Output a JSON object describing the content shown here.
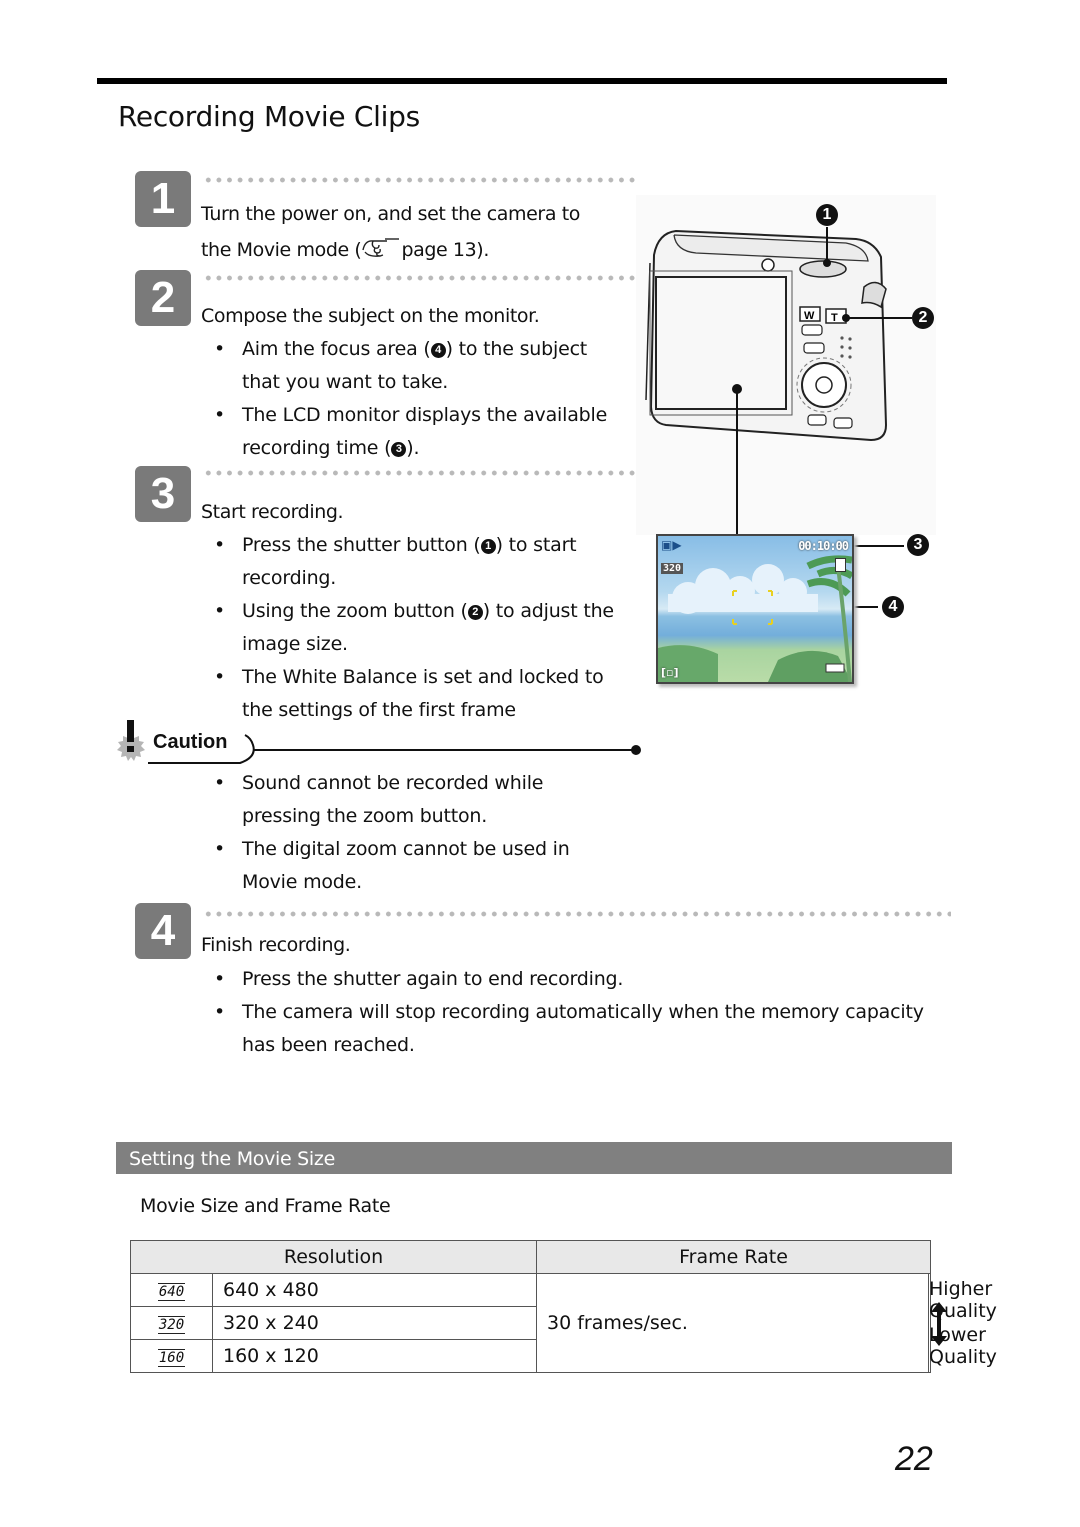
{
  "page": {
    "title": "Recording Movie Clips",
    "page_number": "22"
  },
  "steps": [
    {
      "number": "1",
      "heading_line1": "Turn the power on, and set the camera to",
      "heading_line2_prefix": "the Movie mode (",
      "heading_line2_suffix": "page 13).",
      "reference_icon": "pointing-hand-icon",
      "bullets": []
    },
    {
      "number": "2",
      "heading": "Compose the subject on the monitor.",
      "bullets": [
        {
          "pre": "Aim the focus area (",
          "callout": "4",
          "post": ") to the subject",
          "line2": "that you want to take."
        },
        {
          "pre": "The LCD monitor displays the available",
          "callout": "",
          "post": "",
          "line2_pre": "recording time (",
          "line2_callout": "3",
          "line2_post": ")."
        }
      ]
    },
    {
      "number": "3",
      "heading": "Start recording.",
      "bullets": [
        {
          "pre": "Press the shutter button (",
          "callout": "1",
          "post": ") to start",
          "line2": "recording."
        },
        {
          "pre": "Using the zoom button (",
          "callout": "2",
          "post": ") to adjust the",
          "line2": "image size."
        },
        {
          "pre": "The White Balance is set and locked to",
          "callout": "",
          "post": "",
          "line2": "the settings of the first frame"
        }
      ]
    },
    {
      "number": "4",
      "heading": "Finish recording.",
      "bullets": [
        {
          "line1": "Press the shutter again to end recording."
        },
        {
          "line1": "The camera will stop recording automatically when the memory capacity",
          "line2": "has been reached."
        }
      ]
    }
  ],
  "caution": {
    "label": "Caution",
    "icon": "caution-exclamation-icon",
    "bullets": [
      {
        "line1": "Sound cannot be recorded while",
        "line2": "pressing the zoom button."
      },
      {
        "line1": "The digital zoom cannot be used in",
        "line2": "Movie mode."
      }
    ]
  },
  "illustration": {
    "callouts": [
      "1",
      "2",
      "3",
      "4"
    ],
    "lcd": {
      "timer": "00:10:00",
      "size_icon": "320",
      "mode_icon": "movie-camera-icon",
      "focus_icon": "focus-frame-icon",
      "battery_icon": "battery-icon",
      "memory_icon": "memory-card-icon"
    },
    "zoom_buttons": [
      "W",
      "T"
    ]
  },
  "section": {
    "title": "Setting the Movie Size",
    "subheading": "Movie Size and Frame Rate"
  },
  "table": {
    "headers": [
      "Resolution",
      "Frame Rate"
    ],
    "rows": [
      {
        "icon": "640",
        "resolution": "640 x 480"
      },
      {
        "icon": "320",
        "resolution": "320 x 240"
      },
      {
        "icon": "160",
        "resolution": "160 x 120"
      }
    ],
    "frame_rate": "30 frames/sec.",
    "quality_high": "Higher Quality",
    "quality_low": "Lower Quality"
  },
  "colors": {
    "badge": "#7a7a7a",
    "section_bar": "#808080",
    "table_header": "#e8e8e8",
    "lcd_sky": "#8fc2e6"
  }
}
